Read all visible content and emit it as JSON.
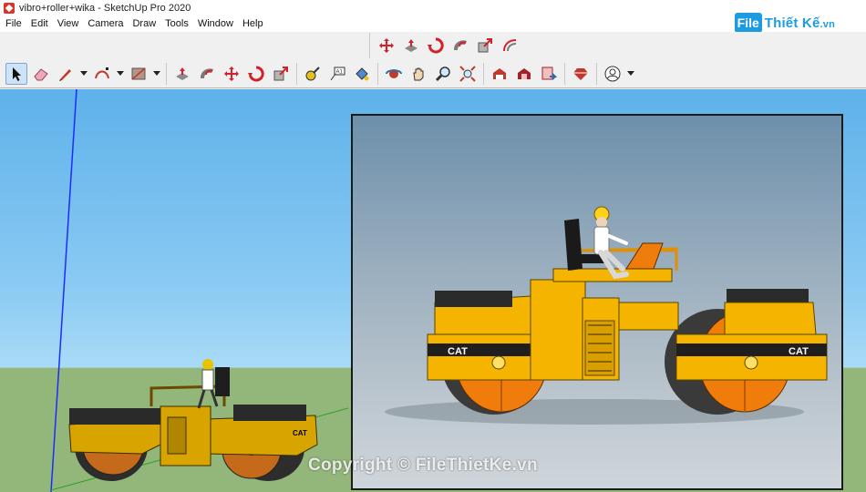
{
  "window": {
    "title": "vibro+roller+wika - SketchUp Pro 2020"
  },
  "menu": {
    "items": [
      "File",
      "Edit",
      "View",
      "Camera",
      "Draw",
      "Tools",
      "Window",
      "Help"
    ]
  },
  "brand": {
    "icon_text": "File",
    "name": "Thiết Kế",
    "suffix": ".vn"
  },
  "viewport": {
    "model_left": {
      "brand_label": "CAT"
    },
    "render": {
      "brand_label_front": "CAT",
      "brand_label_rear": "CAT"
    },
    "watermark": "Copyright © FileThietKe.vn"
  },
  "toolbar": {
    "row1_icons": [
      "orbit-icon",
      "pan-icon",
      "rotate-icon",
      "follow-me-icon",
      "scale-icon",
      "offset-icon"
    ],
    "row2_icons": [
      "select-icon",
      "eraser-icon",
      "pencil-line-icon",
      "arc-icon",
      "rectangle-icon",
      "push-pull-icon",
      "follow-me-icon",
      "move-icon",
      "rotate-icon",
      "scale-icon",
      "tape-measure-icon",
      "text-icon",
      "paint-bucket-icon",
      "orbit-icon",
      "pan-icon",
      "zoom-icon",
      "zoom-extents-icon",
      "warehouse-icon",
      "extension-warehouse-icon",
      "layout-icon",
      "ruby-console-icon",
      "profile-icon"
    ]
  },
  "colors": {
    "sky_top": "#5eb1ea",
    "ground": "#93b77a",
    "roller_yellow": "#f5b400",
    "drum_orange": "#f07c0c",
    "axis_blue": "#1c2cff",
    "axis_green": "#27a327"
  }
}
